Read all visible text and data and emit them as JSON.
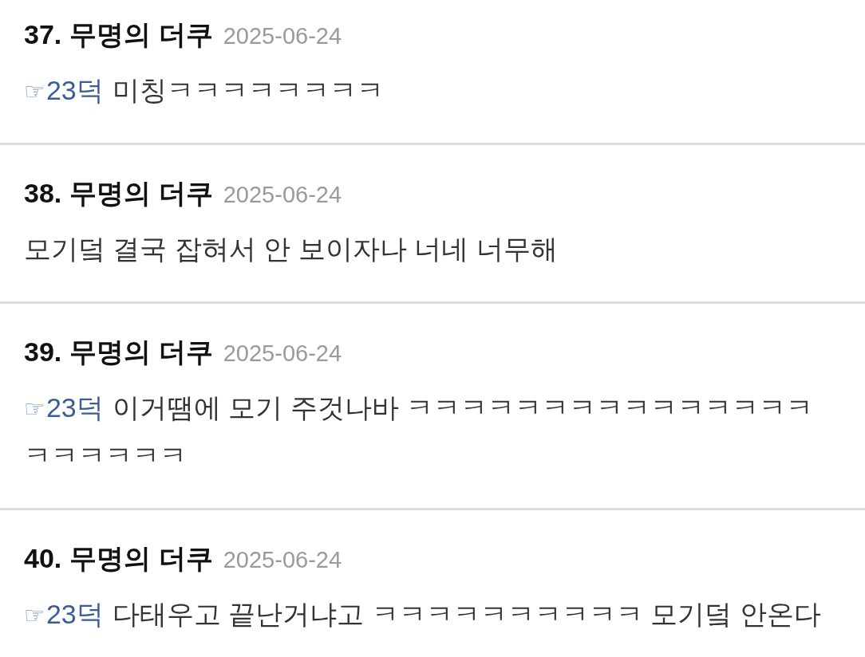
{
  "comments": [
    {
      "number": "37.",
      "author": "무명의 더쿠",
      "date": "2025-06-24",
      "reply_to": {
        "marker": "☞",
        "label": "23덕"
      },
      "lines": [
        "미칭ㅋㅋㅋㅋㅋㅋㅋㅋ"
      ]
    },
    {
      "number": "38.",
      "author": "무명의 더쿠",
      "date": "2025-06-24",
      "lines": [
        "모기덬 결국 잡혀서 안 보이자나 너네 너무해"
      ]
    },
    {
      "number": "39.",
      "author": "무명의 더쿠",
      "date": "2025-06-24",
      "reply_to": {
        "marker": "☞",
        "label": "23덕"
      },
      "lines": [
        "이거땜에 모기 주것나바 ㅋㅋㅋㅋㅋㅋㅋㅋㅋㅋㅋㅋㅋㅋㅋ",
        "ㅋㅋㅋㅋㅋㅋ"
      ]
    },
    {
      "number": "40.",
      "author": "무명의 더쿠",
      "date": "2025-06-24",
      "reply_to": {
        "marker": "☞",
        "label": "23덕"
      },
      "lines": [
        "다태우고 끝난거냐고 ㅋㅋㅋㅋㅋㅋㅋㅋㅋㅋ 모기덬 안온다"
      ]
    }
  ]
}
